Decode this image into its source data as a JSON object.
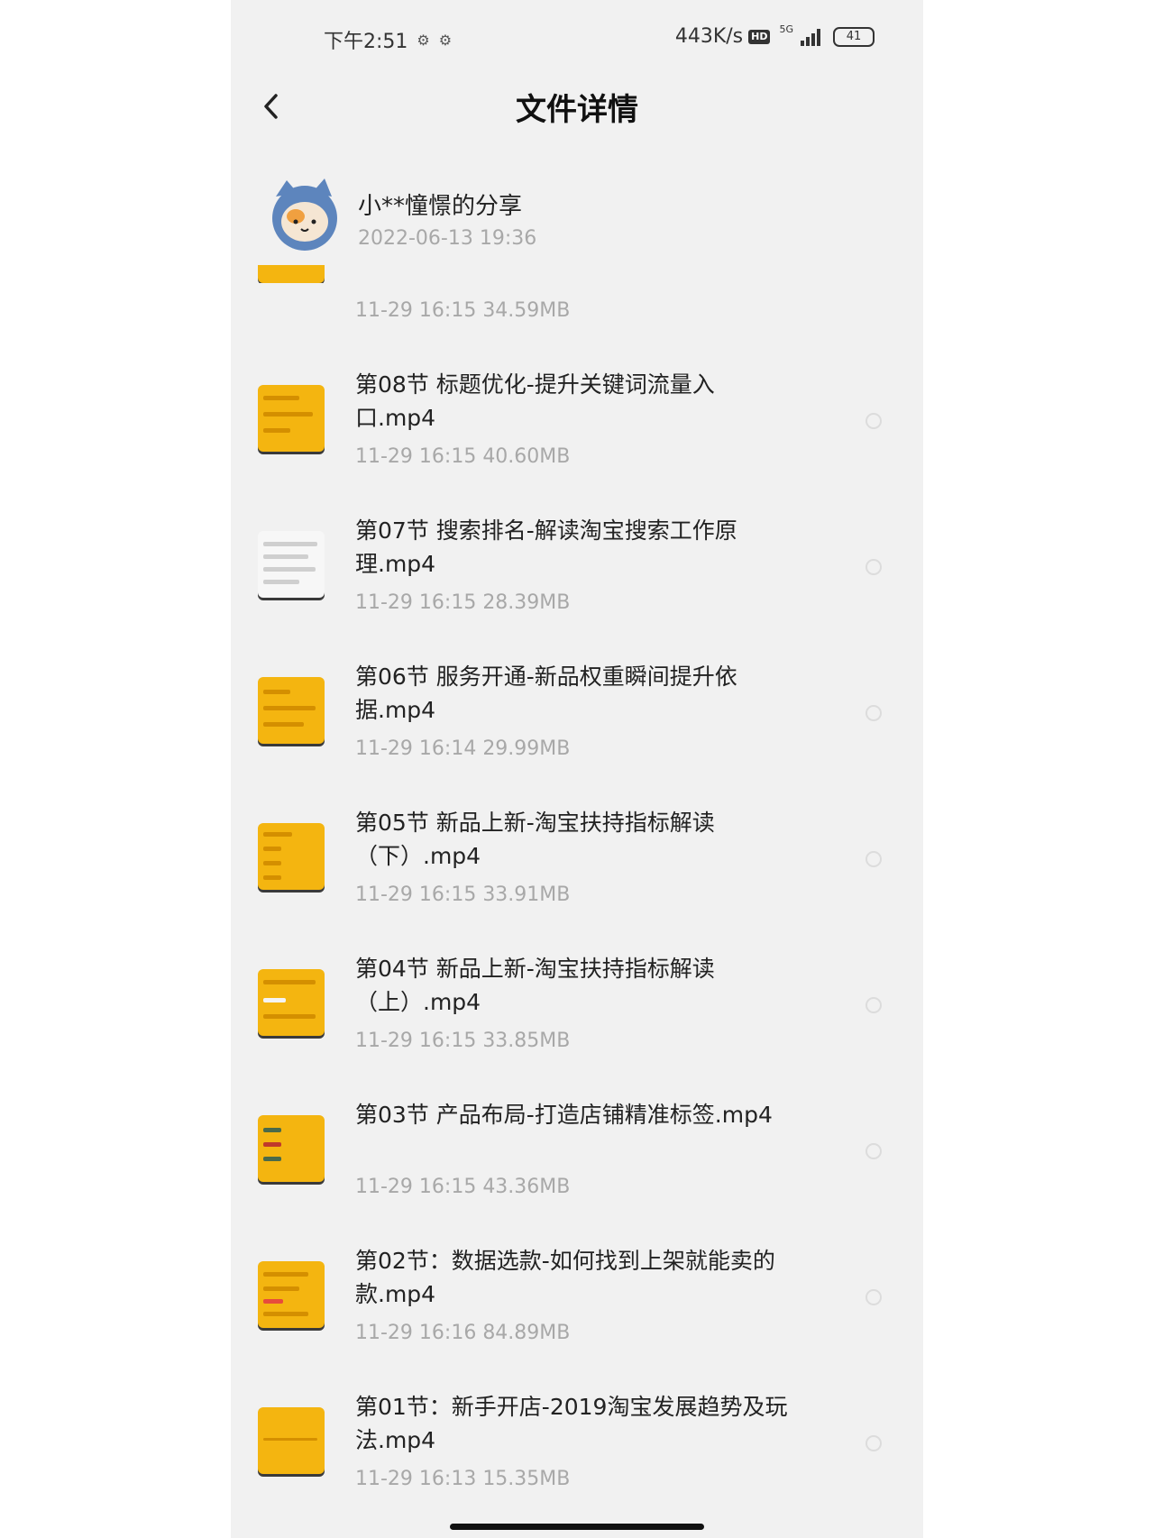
{
  "status_bar": {
    "time": "下午2:51",
    "net_speed": "443K/s",
    "hd": "HD",
    "network": "5G",
    "battery": "41"
  },
  "header": {
    "title": "文件详情"
  },
  "sharer": {
    "name": "小**憧憬的分享",
    "time": "2022-06-13  19:36"
  },
  "partial_item": {
    "meta": "11-29  16:15  34.59MB"
  },
  "files": [
    {
      "name": "第08节 标题优化-提升关键词流量入口.mp4",
      "meta": "11-29  16:15  40.60MB"
    },
    {
      "name": "第07节 搜索排名-解读淘宝搜索工作原理.mp4",
      "meta": "11-29  16:15  28.39MB"
    },
    {
      "name": "第06节 服务开通-新品权重瞬间提升依据.mp4",
      "meta": "11-29  16:14  29.99MB"
    },
    {
      "name": "第05节 新品上新-淘宝扶持指标解读（下）.mp4",
      "meta": "11-29  16:15  33.91MB"
    },
    {
      "name": "第04节 新品上新-淘宝扶持指标解读（上）.mp4",
      "meta": "11-29  16:15  33.85MB"
    },
    {
      "name": "第03节 产品布局-打造店铺精准标签.mp4",
      "meta": "11-29  16:15  43.36MB"
    },
    {
      "name": "第02节：数据选款-如何找到上架就能卖的款.mp4",
      "meta": "11-29  16:16  84.89MB"
    },
    {
      "name": "第01节：新手开店-2019淘宝发展趋势及玩法.mp4",
      "meta": "11-29  16:13  15.35MB"
    }
  ],
  "colors": {
    "thumb_yellow": "#f4b510",
    "meta_gray": "#a8a8a8",
    "background": "#f1f1f1"
  },
  "icons": {
    "back": "back-arrow-icon",
    "avatar": "cat-avatar-icon"
  }
}
